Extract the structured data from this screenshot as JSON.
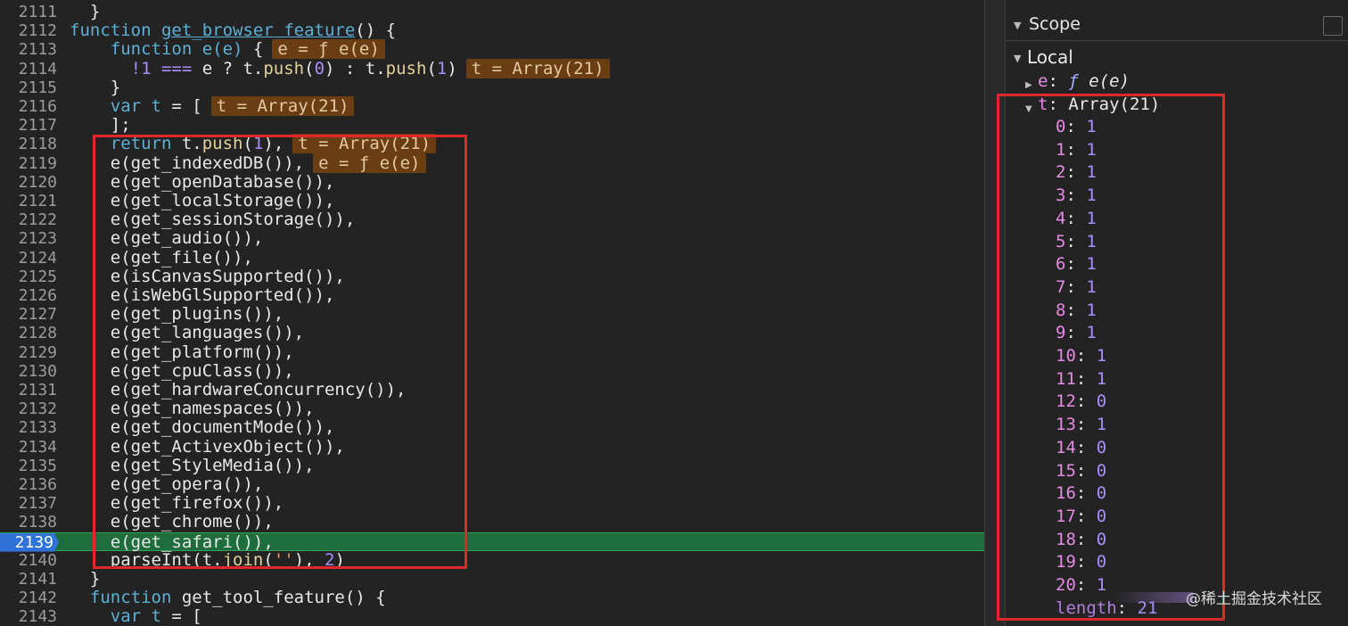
{
  "editor": {
    "lines": [
      {
        "num": "2111",
        "tokens": [
          {
            "t": "  }",
            "c": "op"
          }
        ]
      },
      {
        "num": "2112",
        "tokens": [
          {
            "t": "function ",
            "c": "kw"
          },
          {
            "t": "get_browser_feature",
            "c": "hlfn"
          },
          {
            "t": "() {",
            "c": "op"
          }
        ]
      },
      {
        "num": "2113",
        "tokens": [
          {
            "t": "    function ",
            "c": "kw"
          },
          {
            "t": "e(e)",
            "c": "kw"
          },
          {
            "t": " {",
            "c": "op"
          },
          {
            "t": "e = ƒ e(e)",
            "c": "inl"
          }
        ]
      },
      {
        "num": "2114",
        "tokens": [
          {
            "t": "      !1 === ",
            "c": "num"
          },
          {
            "t": "e ? t.",
            "c": "op"
          },
          {
            "t": "push",
            "c": "pushfn"
          },
          {
            "t": "(",
            "c": "op"
          },
          {
            "t": "0",
            "c": "num"
          },
          {
            "t": ") : t.",
            "c": "op"
          },
          {
            "t": "push",
            "c": "pushfn"
          },
          {
            "t": "(",
            "c": "op"
          },
          {
            "t": "1",
            "c": "num"
          },
          {
            "t": ")",
            "c": "op"
          },
          {
            "t": "t = Array(21)",
            "c": "inl"
          }
        ]
      },
      {
        "num": "2115",
        "tokens": [
          {
            "t": "    }",
            "c": "op"
          }
        ]
      },
      {
        "num": "2116",
        "tokens": [
          {
            "t": "    var ",
            "c": "kw"
          },
          {
            "t": "t",
            "c": "kw"
          },
          {
            "t": " = [",
            "c": "op"
          },
          {
            "t": "t = Array(21)",
            "c": "inl"
          }
        ]
      },
      {
        "num": "2117",
        "tokens": [
          {
            "t": "    ];",
            "c": "op"
          }
        ]
      },
      {
        "num": "2118",
        "tokens": [
          {
            "t": "    return ",
            "c": "kw"
          },
          {
            "t": "t.",
            "c": "op"
          },
          {
            "t": "push",
            "c": "pushfn"
          },
          {
            "t": "(",
            "c": "op"
          },
          {
            "t": "1",
            "c": "num"
          },
          {
            "t": "),",
            "c": "op"
          },
          {
            "t": "t = Array(21)",
            "c": "inl"
          }
        ]
      },
      {
        "num": "2119",
        "tokens": [
          {
            "t": "    e(get_indexedDB()),",
            "c": "op"
          },
          {
            "t": "e = ƒ e(e)",
            "c": "inl"
          }
        ]
      },
      {
        "num": "2120",
        "tokens": [
          {
            "t": "    e(get_openDatabase()),",
            "c": "op"
          }
        ]
      },
      {
        "num": "2121",
        "tokens": [
          {
            "t": "    e(get_localStorage()),",
            "c": "op"
          }
        ]
      },
      {
        "num": "2122",
        "tokens": [
          {
            "t": "    e(get_sessionStorage()),",
            "c": "op"
          }
        ]
      },
      {
        "num": "2123",
        "tokens": [
          {
            "t": "    e(get_audio()),",
            "c": "op"
          }
        ]
      },
      {
        "num": "2124",
        "tokens": [
          {
            "t": "    e(get_file()),",
            "c": "op"
          }
        ]
      },
      {
        "num": "2125",
        "tokens": [
          {
            "t": "    e(isCanvasSupported()),",
            "c": "op"
          }
        ]
      },
      {
        "num": "2126",
        "tokens": [
          {
            "t": "    e(isWebGlSupported()),",
            "c": "op"
          }
        ]
      },
      {
        "num": "2127",
        "tokens": [
          {
            "t": "    e(get_plugins()),",
            "c": "op"
          }
        ]
      },
      {
        "num": "2128",
        "tokens": [
          {
            "t": "    e(get_languages()),",
            "c": "op"
          }
        ]
      },
      {
        "num": "2129",
        "tokens": [
          {
            "t": "    e(get_platform()),",
            "c": "op"
          }
        ]
      },
      {
        "num": "2130",
        "tokens": [
          {
            "t": "    e(get_cpuClass()),",
            "c": "op"
          }
        ]
      },
      {
        "num": "2131",
        "tokens": [
          {
            "t": "    e(get_hardwareConcurrency()),",
            "c": "op"
          }
        ]
      },
      {
        "num": "2132",
        "tokens": [
          {
            "t": "    e(get_namespaces()),",
            "c": "op"
          }
        ]
      },
      {
        "num": "2133",
        "tokens": [
          {
            "t": "    e(get_documentMode()),",
            "c": "op"
          }
        ]
      },
      {
        "num": "2134",
        "tokens": [
          {
            "t": "    e(get_ActivexObject()),",
            "c": "op"
          }
        ]
      },
      {
        "num": "2135",
        "tokens": [
          {
            "t": "    e(get_StyleMedia()),",
            "c": "op"
          }
        ]
      },
      {
        "num": "2136",
        "tokens": [
          {
            "t": "    e(get_opera()),",
            "c": "op"
          }
        ]
      },
      {
        "num": "2137",
        "tokens": [
          {
            "t": "    e(get_firefox()),",
            "c": "op"
          }
        ]
      },
      {
        "num": "2138",
        "tokens": [
          {
            "t": "    e(get_chrome()),",
            "c": "op"
          }
        ]
      },
      {
        "num": "2139",
        "current": true,
        "tokens": [
          {
            "t": "    e(get_safari()),",
            "c": "op"
          }
        ]
      },
      {
        "num": "2140",
        "tokens": [
          {
            "t": "    parseInt(t.",
            "c": "op"
          },
          {
            "t": "join",
            "c": "pushfn"
          },
          {
            "t": "(",
            "c": "op"
          },
          {
            "t": "''",
            "c": "str"
          },
          {
            "t": "), ",
            "c": "op"
          },
          {
            "t": "2",
            "c": "num"
          },
          {
            "t": ")",
            "c": "op"
          }
        ]
      },
      {
        "num": "2141",
        "tokens": [
          {
            "t": "  }",
            "c": "op"
          }
        ]
      },
      {
        "num": "2142",
        "tokens": [
          {
            "t": "  function ",
            "c": "kw"
          },
          {
            "t": "get_tool_feature",
            "c": "fn"
          },
          {
            "t": "() {",
            "c": "op"
          }
        ]
      },
      {
        "num": "2143",
        "tokens": [
          {
            "t": "    var ",
            "c": "kw"
          },
          {
            "t": "t",
            "c": "kw"
          },
          {
            "t": " = [",
            "c": "op"
          }
        ]
      }
    ]
  },
  "scope": {
    "title": "Scope",
    "local_label": "Local",
    "e_key": "e",
    "e_f": "ƒ",
    "e_value": "e(e)",
    "t_key": "t",
    "t_value": "Array(21)",
    "array_items": [
      {
        "k": "0",
        "v": "1"
      },
      {
        "k": "1",
        "v": "1"
      },
      {
        "k": "2",
        "v": "1"
      },
      {
        "k": "3",
        "v": "1"
      },
      {
        "k": "4",
        "v": "1"
      },
      {
        "k": "5",
        "v": "1"
      },
      {
        "k": "6",
        "v": "1"
      },
      {
        "k": "7",
        "v": "1"
      },
      {
        "k": "8",
        "v": "1"
      },
      {
        "k": "9",
        "v": "1"
      },
      {
        "k": "10",
        "v": "1"
      },
      {
        "k": "11",
        "v": "1"
      },
      {
        "k": "12",
        "v": "0"
      },
      {
        "k": "13",
        "v": "1"
      },
      {
        "k": "14",
        "v": "0"
      },
      {
        "k": "15",
        "v": "0"
      },
      {
        "k": "16",
        "v": "0"
      },
      {
        "k": "17",
        "v": "0"
      },
      {
        "k": "18",
        "v": "0"
      },
      {
        "k": "19",
        "v": "0"
      },
      {
        "k": "20",
        "v": "1"
      }
    ],
    "length_key": "length",
    "length_value": "21"
  },
  "watermark": "@稀土掘金技术社区",
  "colors": {
    "highlight_box": "#e0272b",
    "current_line": "#1f6c3d",
    "breakpoint_marker": "#2f73d8"
  }
}
